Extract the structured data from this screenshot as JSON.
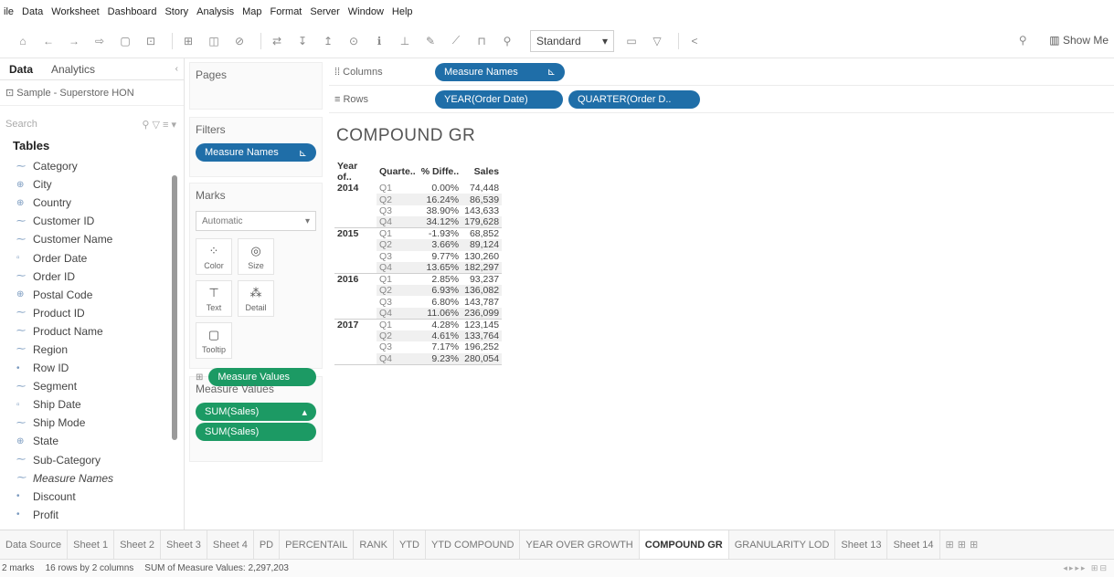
{
  "menu": [
    "ile",
    "Data",
    "Worksheet",
    "Dashboard",
    "Story",
    "Analysis",
    "Map",
    "Format",
    "Server",
    "Window",
    "Help"
  ],
  "toolbar": {
    "fit_select": "Standard",
    "show_me": "Show Me"
  },
  "data_pane": {
    "tab_data": "Data",
    "tab_analytics": "Analytics",
    "source": "Sample - Superstore HON",
    "search_placeholder": "Search",
    "tables_label": "Tables",
    "fields": [
      {
        "name": "Category",
        "icon": "abc"
      },
      {
        "name": "City",
        "icon": "globe"
      },
      {
        "name": "Country",
        "icon": "globe"
      },
      {
        "name": "Customer ID",
        "icon": "abc"
      },
      {
        "name": "Customer Name",
        "icon": "abc"
      },
      {
        "name": "Order Date",
        "icon": "calendar"
      },
      {
        "name": "Order ID",
        "icon": "abc"
      },
      {
        "name": "Postal Code",
        "icon": "globe"
      },
      {
        "name": "Product ID",
        "icon": "abc"
      },
      {
        "name": "Product Name",
        "icon": "abc"
      },
      {
        "name": "Region",
        "icon": "abc"
      },
      {
        "name": "Row ID",
        "icon": "number"
      },
      {
        "name": "Segment",
        "icon": "abc"
      },
      {
        "name": "Ship Date",
        "icon": "calendar"
      },
      {
        "name": "Ship Mode",
        "icon": "abc"
      },
      {
        "name": "State",
        "icon": "globe"
      },
      {
        "name": "Sub-Category",
        "icon": "abc"
      },
      {
        "name": "Measure Names",
        "icon": "abc",
        "italic": true
      },
      {
        "name": "Discount",
        "icon": "number"
      },
      {
        "name": "Profit",
        "icon": "number"
      }
    ]
  },
  "shelves": {
    "pages": "Pages",
    "filters": "Filters",
    "filter_pill": "Measure Names",
    "marks": "Marks",
    "mark_type": "Automatic",
    "mark_buttons": [
      "Color",
      "Size",
      "Text",
      "Detail",
      "Tooltip"
    ],
    "marks_pill": "Measure Values",
    "measure_values": "Measure Values",
    "measure_pills": [
      "SUM(Sales)",
      "SUM(Sales)"
    ]
  },
  "columns": {
    "label": "Columns",
    "pills": [
      "Measure Names"
    ]
  },
  "rows": {
    "label": "Rows",
    "pills": [
      "YEAR(Order Date)",
      "QUARTER(Order D.."
    ]
  },
  "viz": {
    "title": "COMPOUND GR",
    "headers": [
      "Year of..",
      "Quarte..",
      "% Diffe..",
      "Sales"
    ],
    "groups": [
      {
        "year": "2014",
        "rows": [
          [
            "Q1",
            "0.00%",
            "74,448"
          ],
          [
            "Q2",
            "16.24%",
            "86,539"
          ],
          [
            "Q3",
            "38.90%",
            "143,633"
          ],
          [
            "Q4",
            "34.12%",
            "179,628"
          ]
        ]
      },
      {
        "year": "2015",
        "rows": [
          [
            "Q1",
            "-1.93%",
            "68,852"
          ],
          [
            "Q2",
            "3.66%",
            "89,124"
          ],
          [
            "Q3",
            "9.77%",
            "130,260"
          ],
          [
            "Q4",
            "13.65%",
            "182,297"
          ]
        ]
      },
      {
        "year": "2016",
        "rows": [
          [
            "Q1",
            "2.85%",
            "93,237"
          ],
          [
            "Q2",
            "6.93%",
            "136,082"
          ],
          [
            "Q3",
            "6.80%",
            "143,787"
          ],
          [
            "Q4",
            "11.06%",
            "236,099"
          ]
        ]
      },
      {
        "year": "2017",
        "rows": [
          [
            "Q1",
            "4.28%",
            "123,145"
          ],
          [
            "Q2",
            "4.61%",
            "133,764"
          ],
          [
            "Q3",
            "7.17%",
            "196,252"
          ],
          [
            "Q4",
            "9.23%",
            "280,054"
          ]
        ]
      }
    ]
  },
  "sheet_tabs": [
    "Data Source",
    "Sheet 1",
    "Sheet 2",
    "Sheet 3",
    "Sheet 4",
    "PD",
    "PERCENTAIL",
    "RANK",
    "YTD",
    "YTD COMPOUND",
    "YEAR OVER GROWTH",
    "COMPOUND GR",
    "GRANULARITY LOD",
    "Sheet 13",
    "Sheet 14"
  ],
  "active_sheet": "COMPOUND GR",
  "status": {
    "marks": "2 marks",
    "rows_cols": "16 rows by 2 columns",
    "sum": "SUM of Measure Values: 2,297,203"
  }
}
